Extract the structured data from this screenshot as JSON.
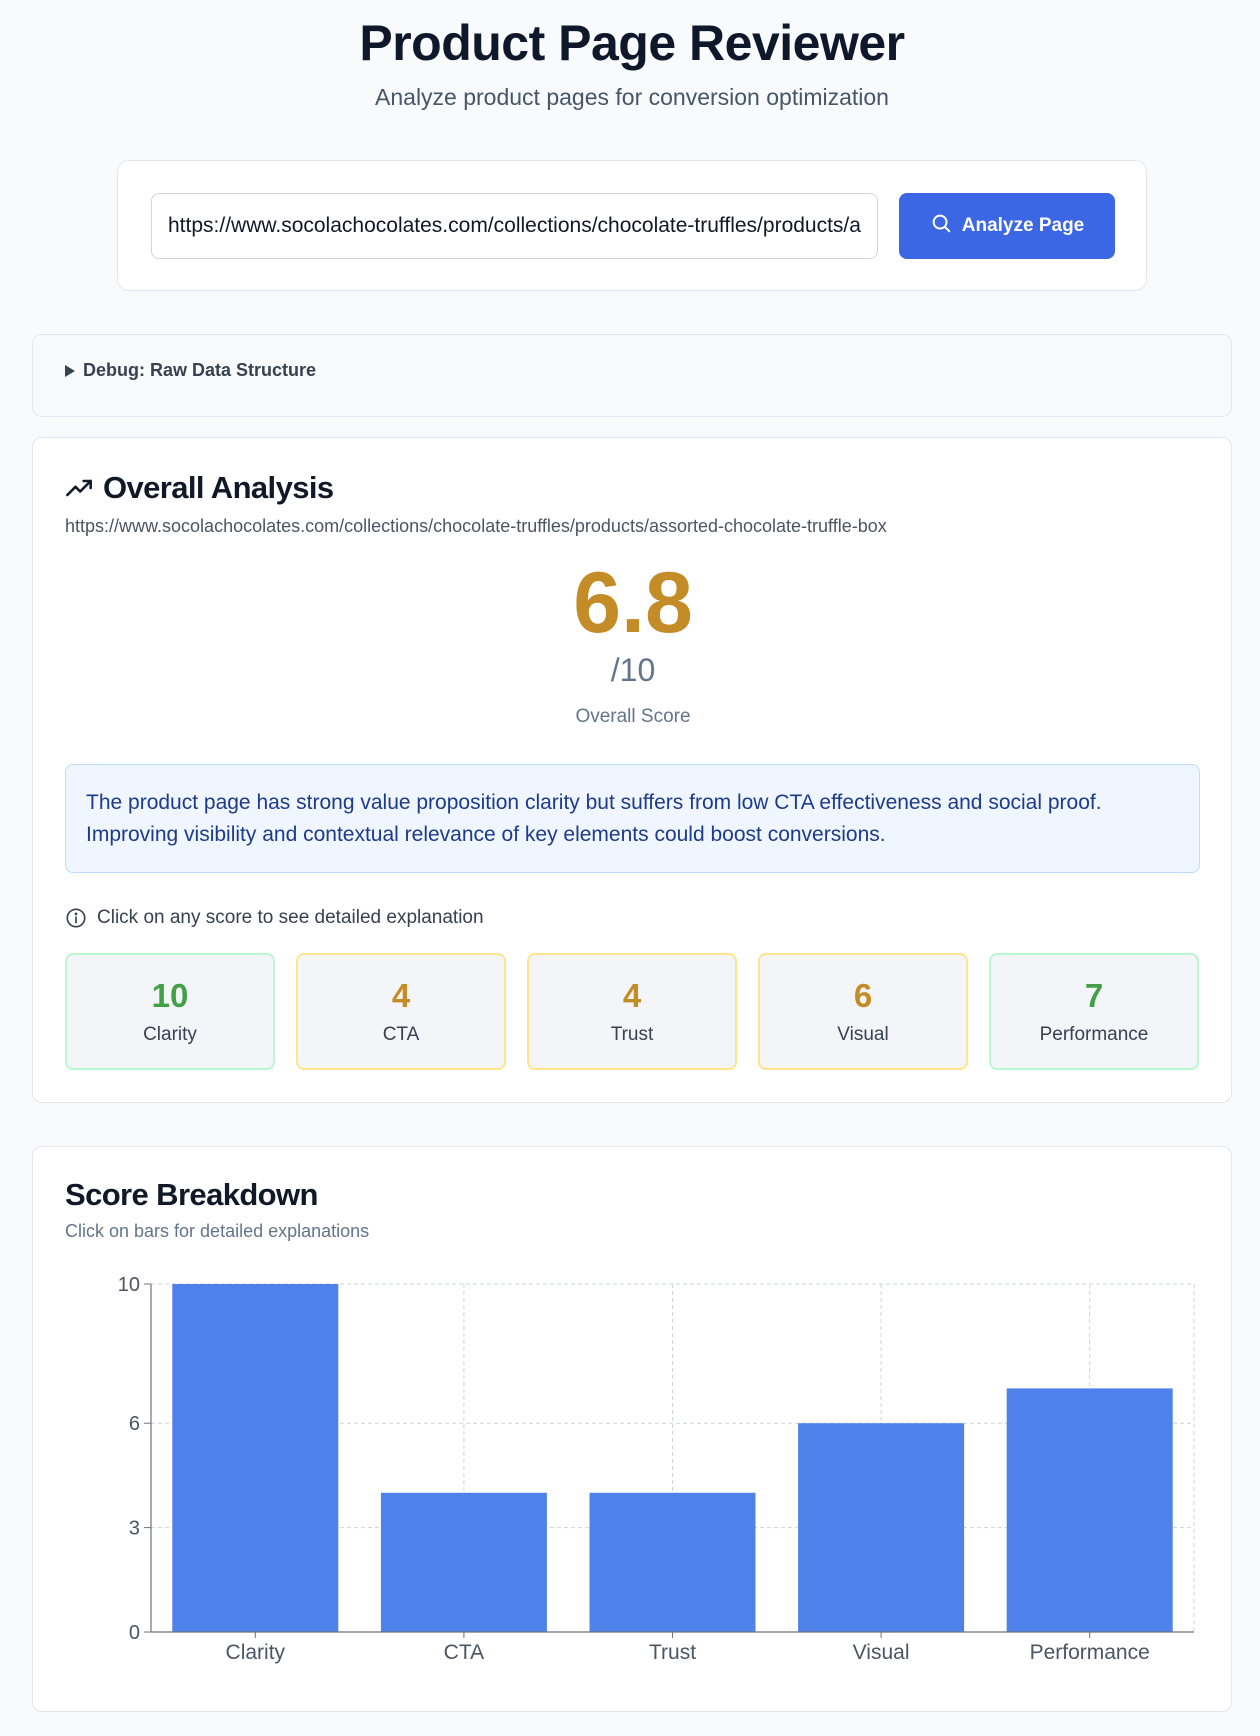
{
  "header": {
    "title": "Product Page Reviewer",
    "subtitle": "Analyze product pages for conversion optimization"
  },
  "search": {
    "url_value": "https://www.socolachocolates.com/collections/chocolate-truffles/products/assorted-chocolate-truffle-box",
    "button_label": "Analyze Page",
    "button_icon": "search-icon",
    "button_color": "#3b66e4"
  },
  "debug": {
    "label": "Debug: Raw Data Structure",
    "icon": "triangle-right-icon"
  },
  "analysis": {
    "heading": "Overall Analysis",
    "heading_icon": "trending-up-icon",
    "url": "https://www.socolachocolates.com/collections/chocolate-truffles/products/assorted-chocolate-truffle-box",
    "score": "6.8",
    "score_max": "/10",
    "score_caption": "Overall Score",
    "score_color": "#c48c26",
    "summary": "The product page has strong value proposition clarity but suffers from low CTA effectiveness and social proof. Improving visibility and contextual relevance of key elements could boost conversions.",
    "hint": "Click on any score to see detailed explanation",
    "hint_icon": "info-icon",
    "metrics": [
      {
        "value": "10",
        "label": "Clarity",
        "tone": "green"
      },
      {
        "value": "4",
        "label": "CTA",
        "tone": "yellow"
      },
      {
        "value": "4",
        "label": "Trust",
        "tone": "yellow"
      },
      {
        "value": "6",
        "label": "Visual",
        "tone": "yellow"
      },
      {
        "value": "7",
        "label": "Performance",
        "tone": "green"
      }
    ],
    "colors": {
      "green": "#43a047",
      "yellow": "#c48c26"
    }
  },
  "breakdown": {
    "title": "Score Breakdown",
    "subtitle": "Click on bars for detailed explanations"
  },
  "chart_data": {
    "type": "bar",
    "categories": [
      "Clarity",
      "CTA",
      "Trust",
      "Visual",
      "Performance"
    ],
    "values": [
      10,
      4,
      4,
      6,
      7
    ],
    "yticks": [
      0,
      3,
      6,
      10
    ],
    "ylim": [
      0,
      10
    ],
    "grid": true,
    "bar_color": "#4f81ea"
  }
}
